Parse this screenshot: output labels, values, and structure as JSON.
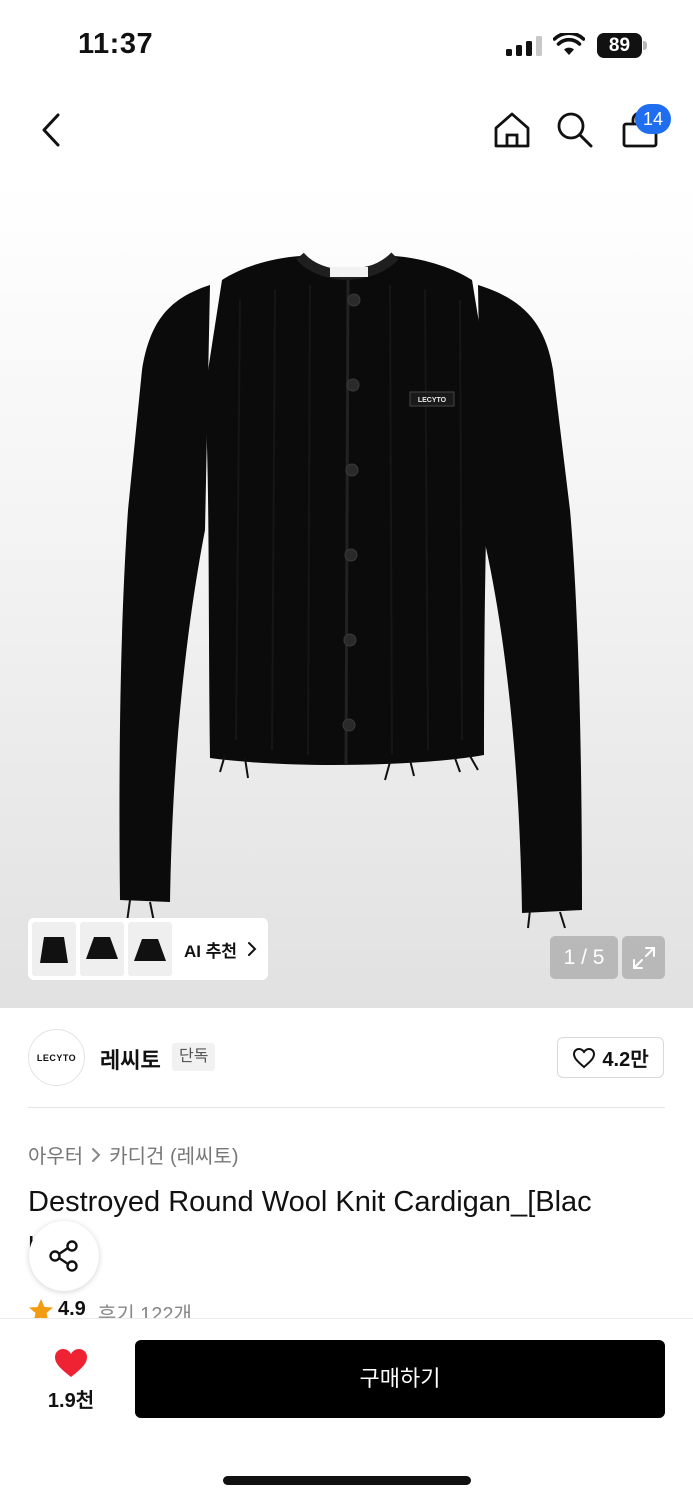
{
  "status_bar": {
    "time": "11:37",
    "battery": "89",
    "icons": [
      "signal-icon",
      "wifi-icon",
      "battery-icon"
    ]
  },
  "nav": {
    "icons": [
      "back-icon",
      "home-icon",
      "search-icon",
      "cart-icon"
    ],
    "cart_badge": "14"
  },
  "gallery": {
    "ai_recommend_label": "AI 추천",
    "page_indicator": "1 / 5",
    "product_label_text": "LECYTO",
    "icons": [
      "chevron-right-icon",
      "expand-icon"
    ]
  },
  "brand": {
    "logo_text": "LECYTO",
    "name": "레씨토",
    "tag": "단독",
    "likes": "4.2만"
  },
  "breadcrumb": {
    "category": "아우터",
    "subcategory": "카디건 (레씨토)"
  },
  "product": {
    "title": "Destroyed Round Wool Knit Cardigan_[Blac",
    "title_line2_fragment": "l"
  },
  "rating": {
    "value": "4.9",
    "reviews": "후기 122개"
  },
  "bottom_bar": {
    "wish_count": "1.9천",
    "buy_label": "구매하기"
  },
  "colors": {
    "accent_blue": "#1f6ef0",
    "heart_red": "#ee2233",
    "star_orange": "#f39c12",
    "buy_button": "#000000"
  }
}
